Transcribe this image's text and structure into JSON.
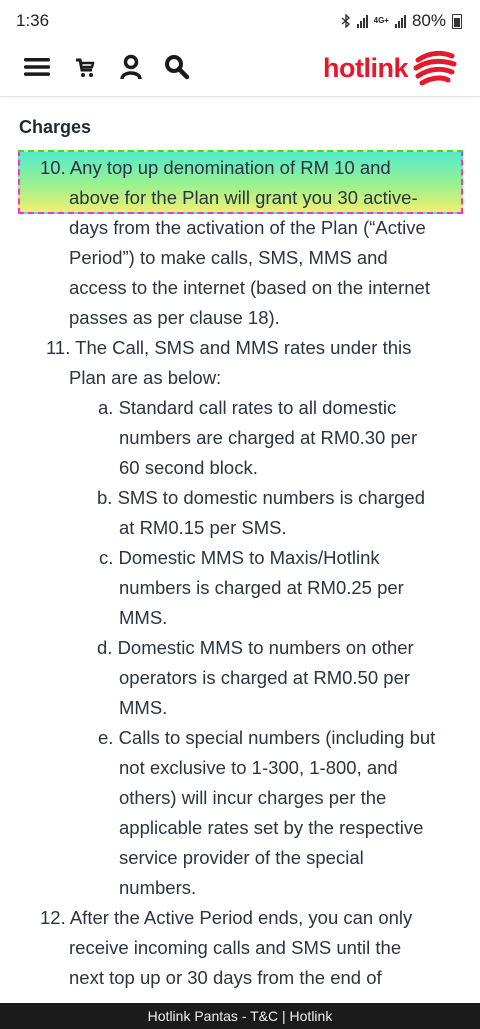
{
  "status_bar": {
    "time": "1:36",
    "network": "4G+",
    "battery": "80%"
  },
  "header": {
    "brand": "hotlink",
    "brand_color": "#e4192b",
    "icons": [
      "menu-icon",
      "cart-icon",
      "account-icon",
      "search-icon"
    ]
  },
  "content": {
    "section_title": "Charges",
    "lines": [
      {
        "text": "10. Any top up denomination of RM 10 and"
      },
      {
        "text": "above for the Plan will grant you 30 active-"
      },
      {
        "text": "days from the activation of the Plan (“Active"
      },
      {
        "text": "Period”) to make calls, SMS, MMS and"
      },
      {
        "text": "access to the internet (based on the internet"
      },
      {
        "text": "passes as per clause 18)."
      },
      {
        "text": "11. The Call, SMS and MMS rates under this"
      },
      {
        "text": "Plan are as below:"
      },
      {
        "text": "a. Standard call rates to all domestic"
      },
      {
        "text": "numbers are charged at RM0.30 per"
      },
      {
        "text": "60 second block."
      },
      {
        "text": "b. SMS to domestic numbers is charged"
      },
      {
        "text": "at RM0.15 per SMS."
      },
      {
        "text": "c. Domestic MMS to Maxis/Hotlink"
      },
      {
        "text": "numbers is charged at RM0.25 per"
      },
      {
        "text": "MMS."
      },
      {
        "text": "d. Domestic MMS to numbers on other"
      },
      {
        "text": "operators is charged at RM0.50 per"
      },
      {
        "text": "MMS."
      },
      {
        "text": "e. Calls to special numbers (including but"
      },
      {
        "text": "not exclusive to 1-300, 1-800, and"
      },
      {
        "text": "others) will incur charges per the"
      },
      {
        "text": "applicable rates set by the respective"
      },
      {
        "text": "service provider of the special"
      },
      {
        "text": "numbers."
      },
      {
        "text": "12. After the Active Period ends, you can only"
      },
      {
        "text": "receive incoming calls and SMS until the"
      },
      {
        "text": "next top up or 30 days from the end of"
      }
    ]
  },
  "footer": {
    "title": "Hotlink Pantas - T&C | Hotlink"
  }
}
